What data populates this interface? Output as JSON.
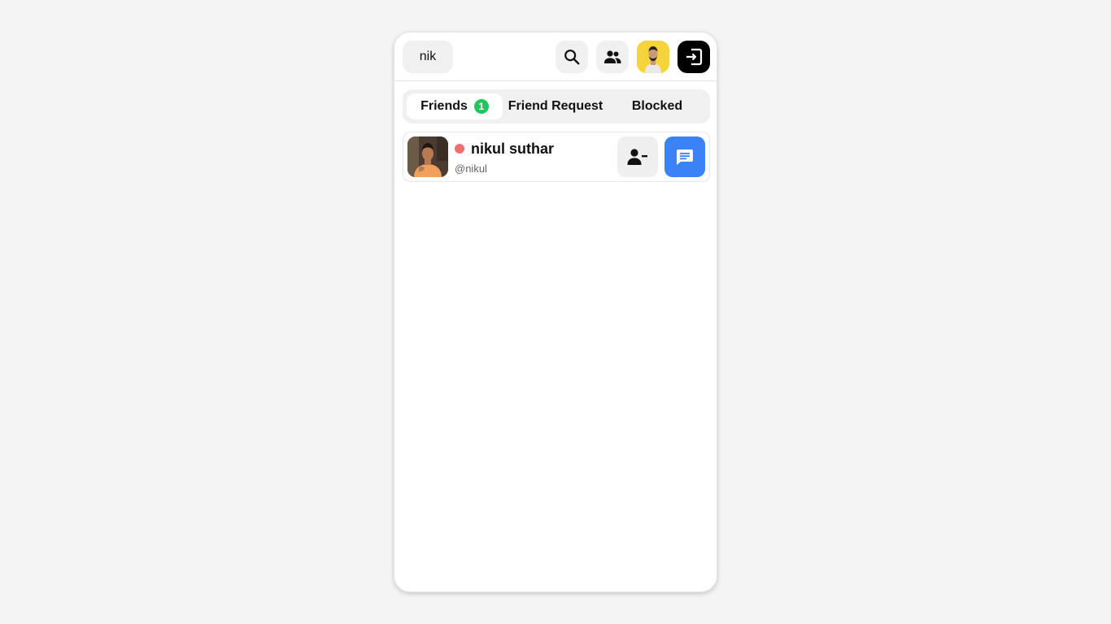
{
  "header": {
    "username": "nik",
    "icons": {
      "search": "search-icon",
      "friends": "people-icon",
      "avatar": "user-avatar",
      "logout": "logout-icon"
    },
    "avatar_bg": "#f5d33a",
    "logout_bg": "#000000"
  },
  "tabs": [
    {
      "label": "Friends",
      "badge": "1",
      "active": true
    },
    {
      "label": "Friend Request",
      "active": false
    },
    {
      "label": "Blocked",
      "active": false
    }
  ],
  "friends": [
    {
      "name": "nikul suthar",
      "handle": "@nikul",
      "status": "offline",
      "status_color": "#f07070",
      "actions": {
        "remove": "remove-friend-icon",
        "message": "message-icon"
      },
      "message_color": "#3b82f6"
    }
  ],
  "colors": {
    "badge": "#22c55e",
    "background": "#f4f4f4"
  }
}
